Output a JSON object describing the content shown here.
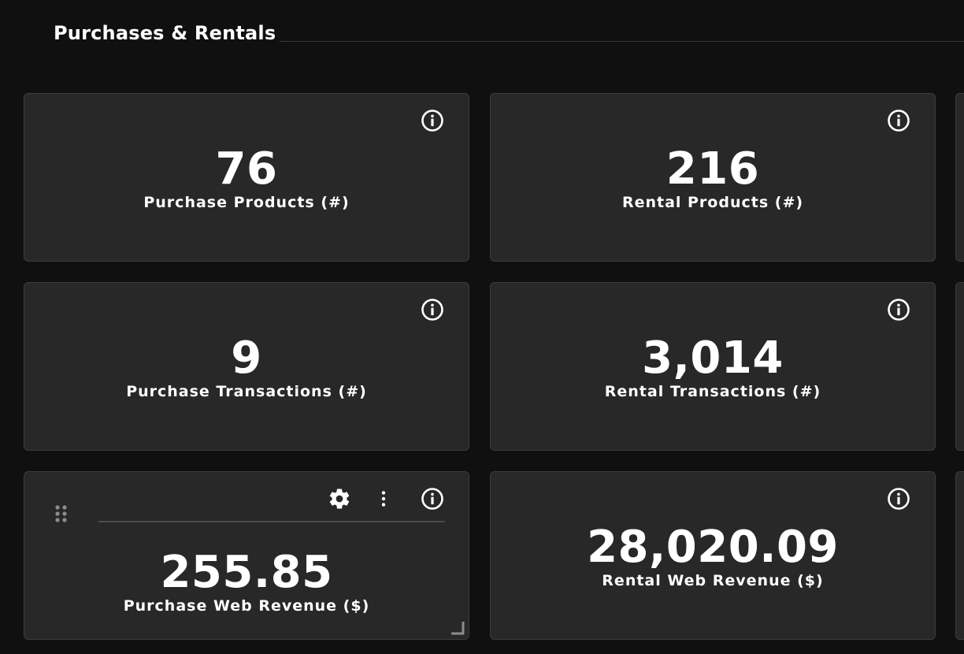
{
  "section": {
    "title": "Purchases & Rentals"
  },
  "cards": {
    "purchase_products": {
      "value": "76",
      "label": "Purchase Products (#)"
    },
    "rental_products": {
      "value": "216",
      "label": "Rental Products (#)"
    },
    "purchase_transactions": {
      "value": "9",
      "label": "Purchase Transactions (#)"
    },
    "rental_transactions": {
      "value": "3,014",
      "label": "Rental Transactions (#)"
    },
    "purchase_web_revenue": {
      "value": "255.85",
      "label": "Purchase Web Revenue ($)"
    },
    "rental_web_revenue": {
      "value": "28,020.09",
      "label": "Rental Web Revenue ($)"
    }
  },
  "colors": {
    "background": "#101010",
    "card": "#282828",
    "text": "#ffffff"
  },
  "icons": {
    "info": "info-icon",
    "settings": "gear-icon",
    "more": "kebab-menu-icon",
    "drag": "drag-handle-icon",
    "resize": "resize-handle-icon"
  }
}
